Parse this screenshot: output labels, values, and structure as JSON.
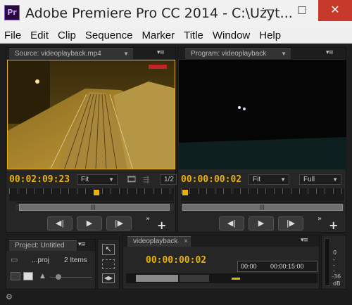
{
  "window": {
    "title": "Adobe Premiere Pro CC 2014 - C:\\Użyt...",
    "app_icon": "Pr",
    "minimize": "—",
    "maximize": "□",
    "close": "✕"
  },
  "menu": [
    "File",
    "Edit",
    "Clip",
    "Sequence",
    "Marker",
    "Title",
    "Window",
    "Help"
  ],
  "source": {
    "tab": "Source: videoplayback.mp4",
    "timecode": "00:02:09:23",
    "fit": "Fit",
    "page": "1/2",
    "playhead_fraction": 0.53
  },
  "program": {
    "tab": "Program: videoplayback",
    "timecode": "00:00:00:02",
    "fit": "Fit",
    "quality": "Full",
    "playhead_fraction": 0.01
  },
  "project": {
    "tab": "Project: Untitled",
    "file": "...proj",
    "items": "2 Items"
  },
  "timeline": {
    "tab": "videoplayback",
    "timecode": "00:00:00:02",
    "time_start": "00:00",
    "time_end": "00:00:15:00"
  },
  "meter": {
    "labels": [
      "0",
      "-",
      "-",
      "-",
      "-36",
      "dB"
    ]
  },
  "icons": {
    "step_back": "◀|",
    "play": "▶",
    "step_forward": "|▶",
    "add": "+",
    "more": "»",
    "panel_menu": "▾≡"
  },
  "colors": {
    "accent": "#e9b10a",
    "close": "#c7392a"
  }
}
